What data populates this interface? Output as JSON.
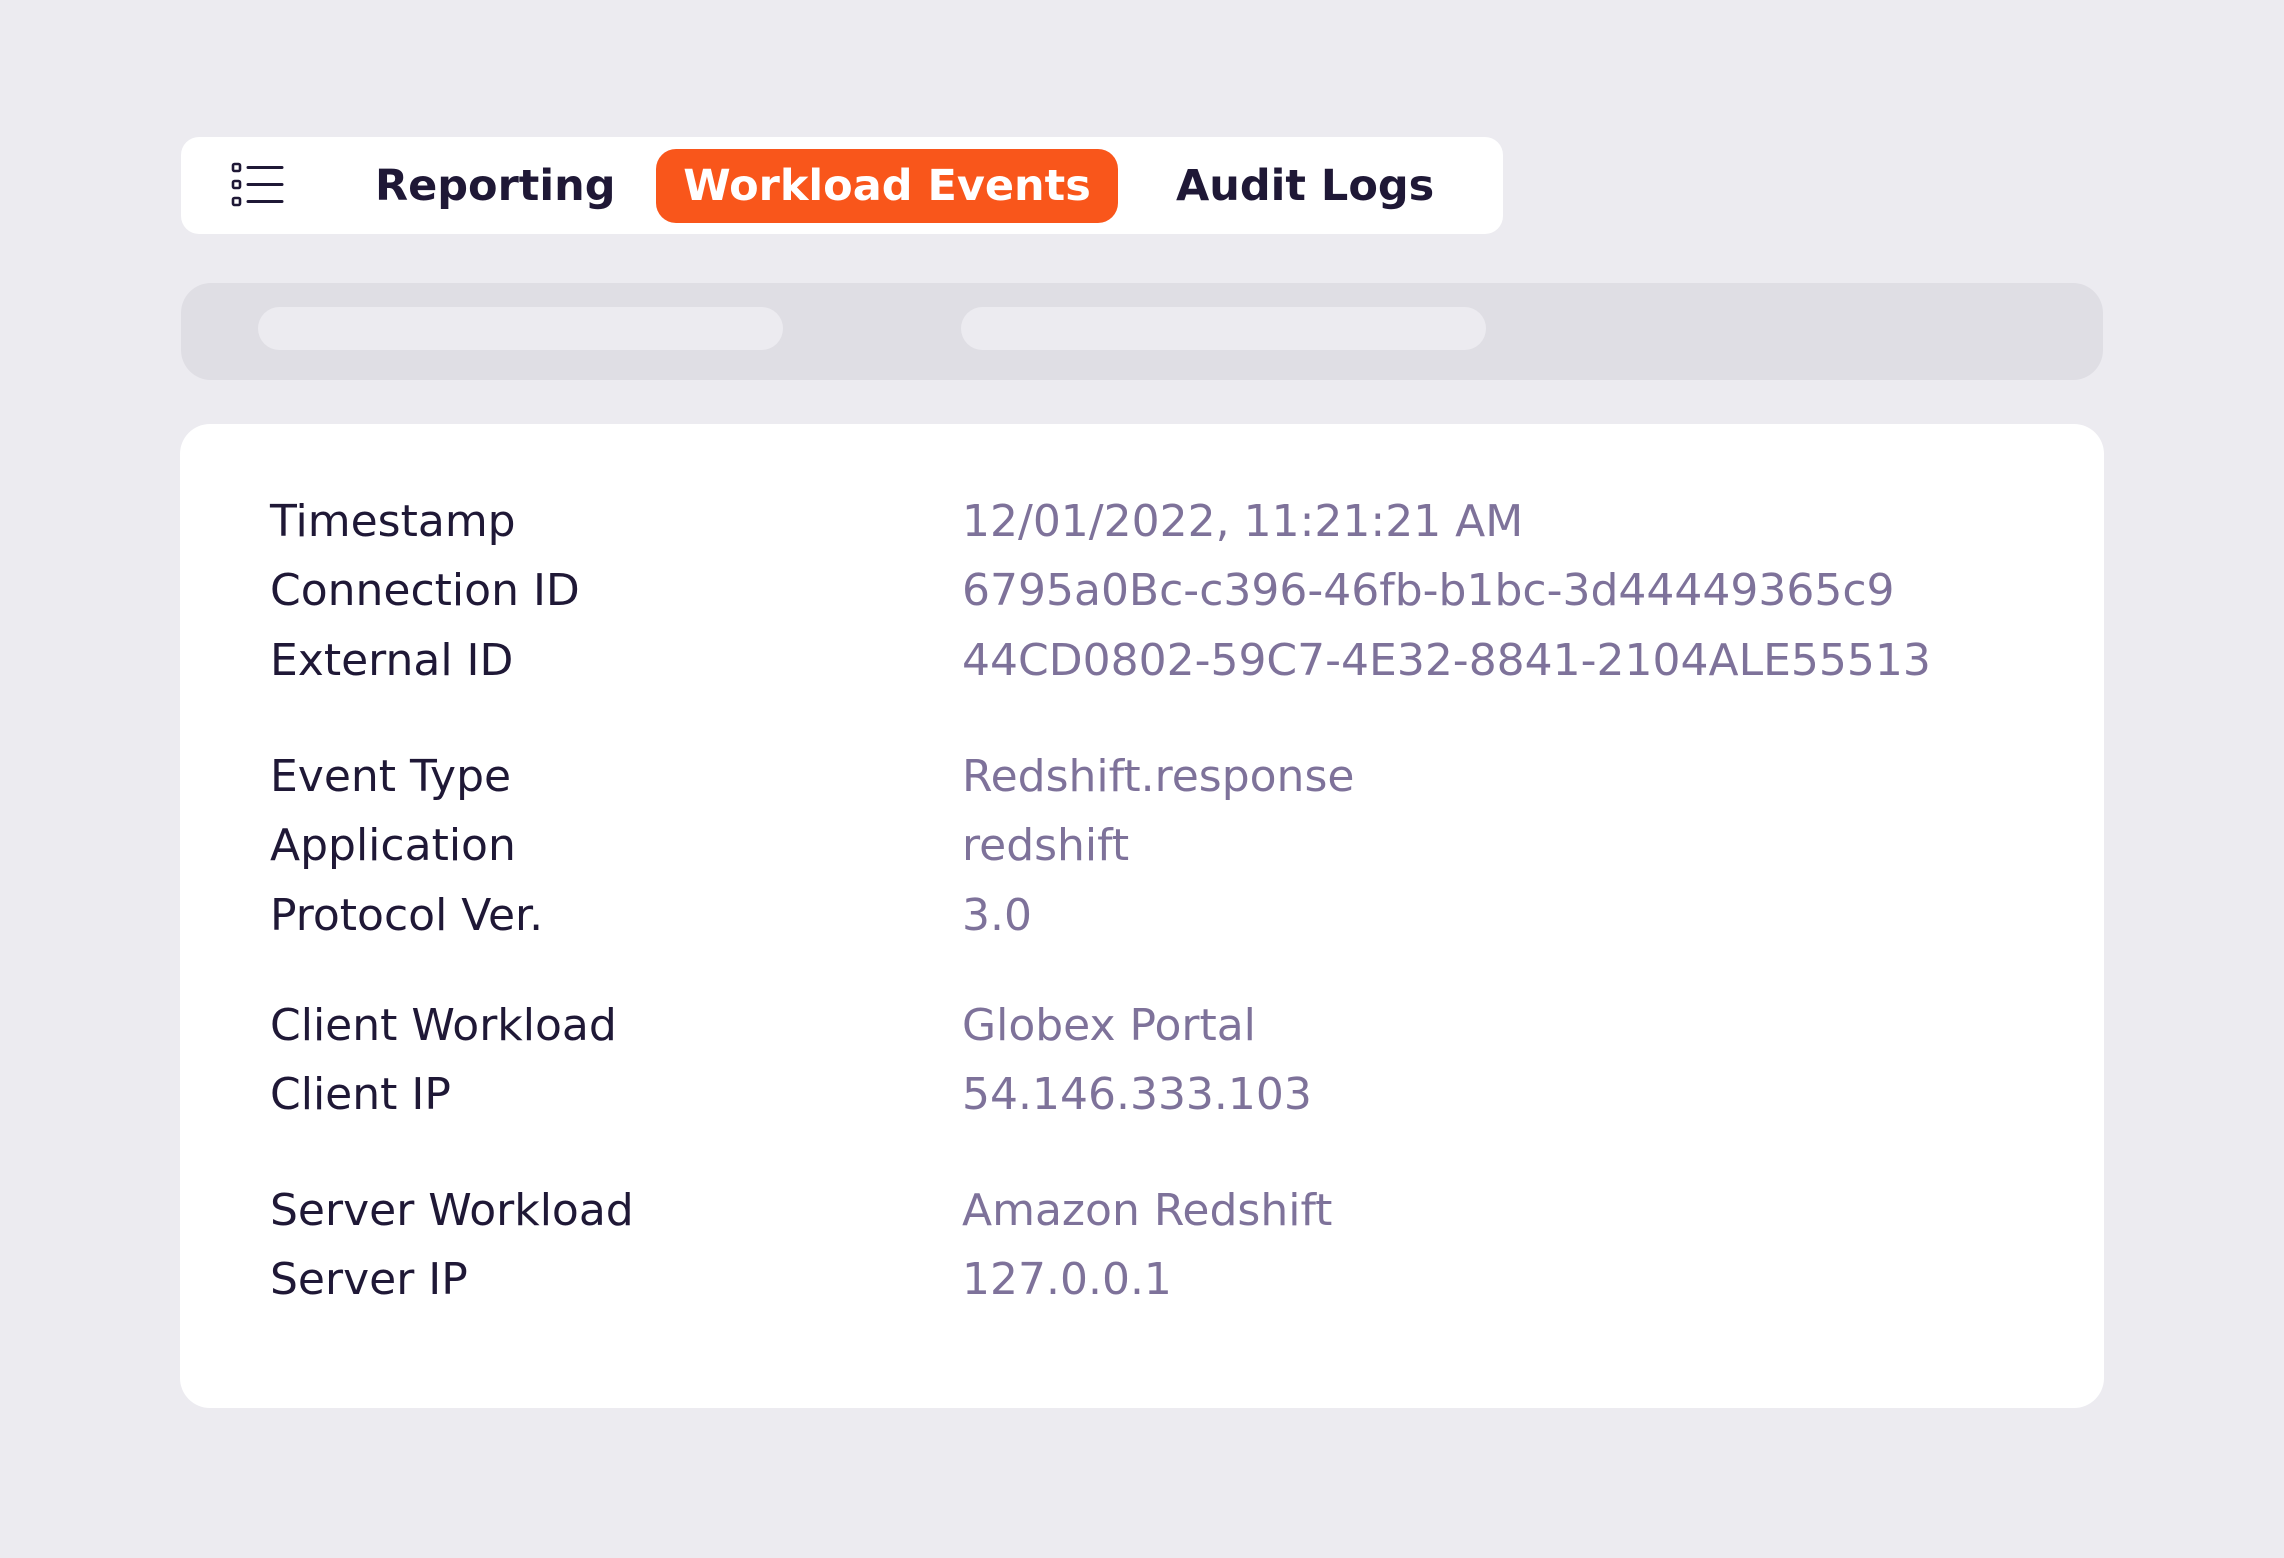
{
  "tabs": {
    "items": [
      {
        "label": "Reporting",
        "active": false
      },
      {
        "label": "Workload Events",
        "active": true
      },
      {
        "label": "Audit Logs",
        "active": false
      }
    ],
    "menu_icon": "list-icon",
    "active_color": "#F9561B"
  },
  "details": {
    "rows": [
      {
        "label": "Timestamp",
        "value": "12/01/2022, 11:21:21 AM"
      },
      {
        "label": "Connection ID",
        "value": "6795a0Bc-c396-46fb-b1bc-3d44449365c9"
      },
      {
        "label": "External ID",
        "value": "44CD0802-59C7-4E32-8841-2104ALE55513"
      },
      {
        "label": "Event Type",
        "value": "Redshift.response"
      },
      {
        "label": "Application",
        "value": "redshift"
      },
      {
        "label": "Protocol Ver.",
        "value": "3.0"
      },
      {
        "label": "Client Workload",
        "value": "Globex Portal"
      },
      {
        "label": "Client IP",
        "value": "54.146.333.103"
      },
      {
        "label": "Server Workload",
        "value": "Amazon Redshift"
      },
      {
        "label": "Server IP",
        "value": "127.0.0.1"
      }
    ]
  },
  "colors": {
    "background": "#ECEBF0",
    "label_text": "#1F1836",
    "value_text": "#7E729A",
    "accent": "#F9561B"
  }
}
